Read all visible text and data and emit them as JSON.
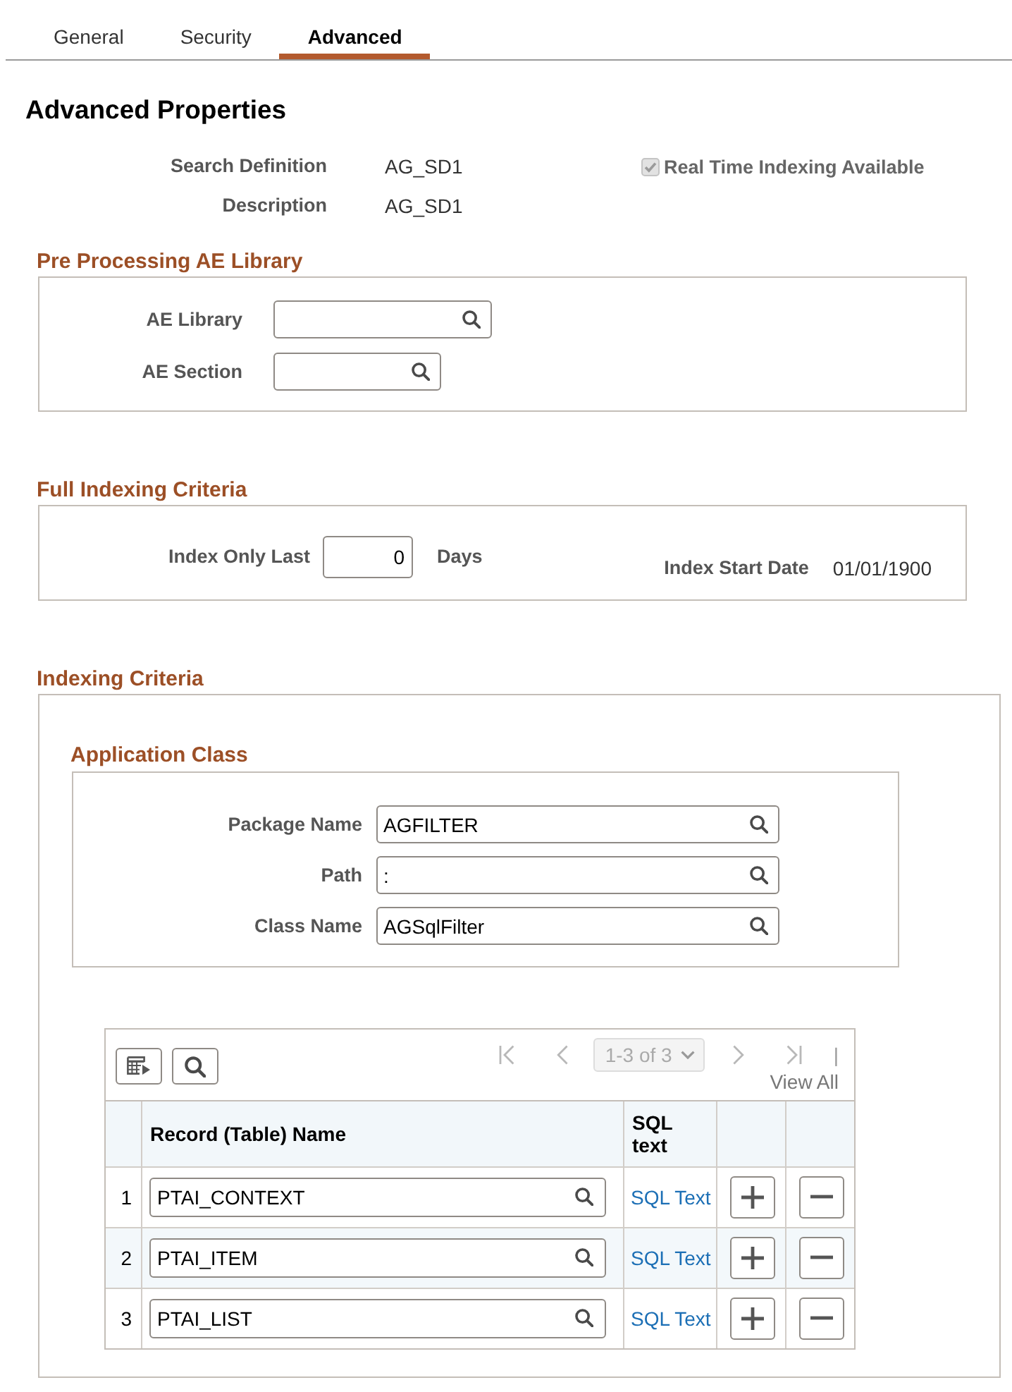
{
  "tabs": [
    {
      "label": "General",
      "selected": false
    },
    {
      "label": "Security",
      "selected": false
    },
    {
      "label": "Advanced",
      "selected": true
    }
  ],
  "page_title": "Advanced Properties",
  "summary": {
    "fields": [
      {
        "label": "Search Definition",
        "value": "AG_SD1"
      },
      {
        "label": "Description",
        "value": "AG_SD1"
      }
    ],
    "option": {
      "label": "Real Time Indexing Available",
      "checked": true,
      "disabled": true
    }
  },
  "pre_processing": {
    "title": "Pre Processing AE Library",
    "fields": [
      {
        "label": "AE Library"
      },
      {
        "label": "AE Section"
      }
    ]
  },
  "full_indexing": {
    "title": "Full Indexing Criteria",
    "index_only_last": {
      "label": "Index Only Last",
      "value": "0",
      "unit": "Days"
    },
    "start_date": {
      "label": "Index Start Date",
      "value": "01/01/1900"
    }
  },
  "indexing_criteria": {
    "title": "Indexing Criteria",
    "application_class": {
      "title": "Application Class",
      "fields": [
        {
          "label": "Package Name",
          "value": "AGFILTER"
        },
        {
          "label": "Path",
          "value": ":"
        },
        {
          "label": "Class Name",
          "value": "AGSqlFilter"
        }
      ]
    },
    "grid": {
      "pagination": {
        "range": "1-3 of 3",
        "disabled": true,
        "separator": "|",
        "view_all": "View All"
      },
      "columns": [
        {
          "label": "Record (Table) Name"
        },
        {
          "label": "SQL text"
        }
      ],
      "rows": [
        {
          "number": "1",
          "record": "PTAI_CONTEXT",
          "link": "SQL Text"
        },
        {
          "number": "2",
          "record": "PTAI_ITEM",
          "link": "SQL Text"
        },
        {
          "number": "3",
          "record": "PTAI_LIST",
          "link": "SQL Text"
        }
      ]
    }
  }
}
